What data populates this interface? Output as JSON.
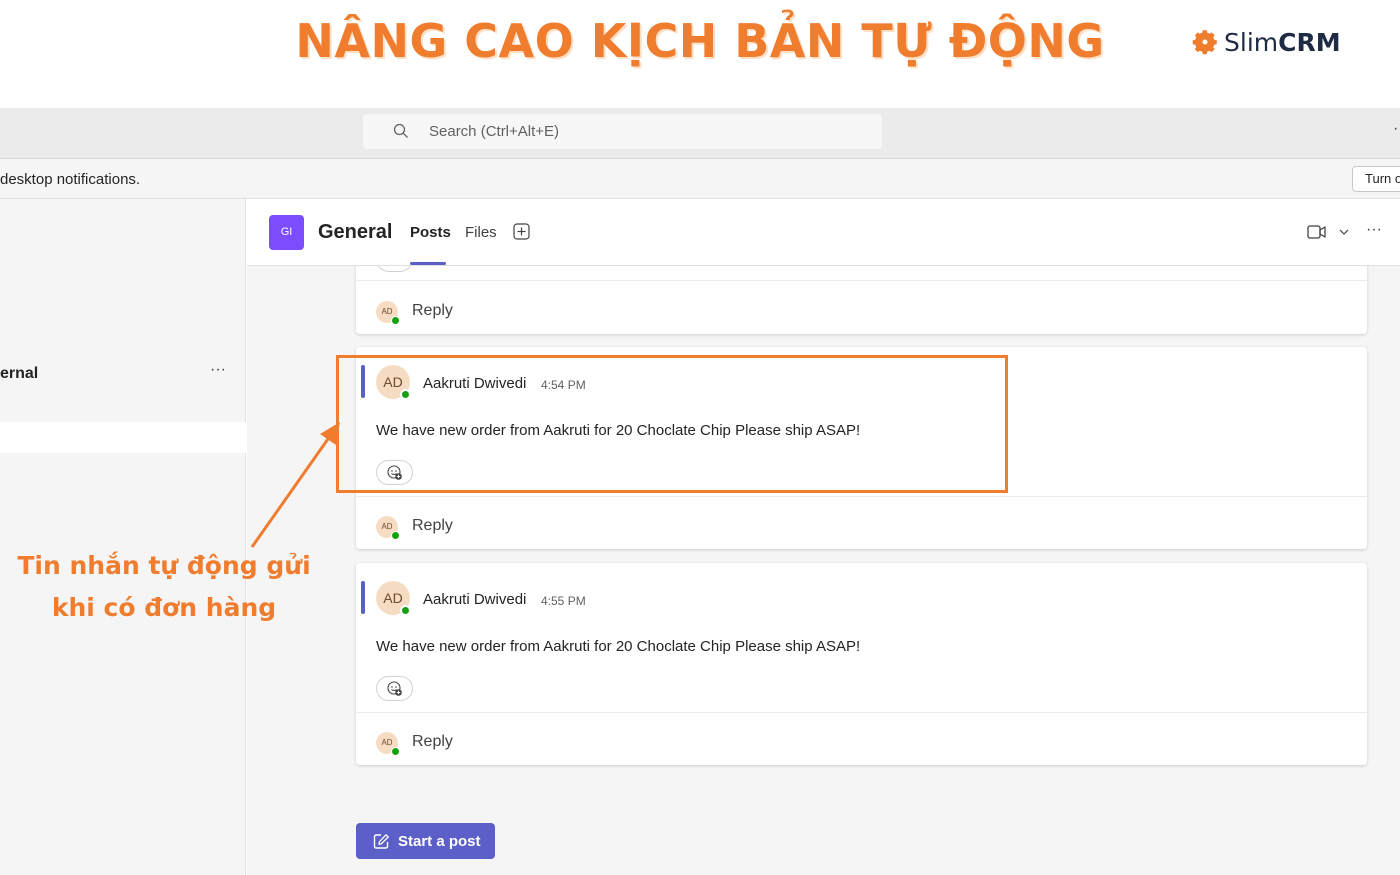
{
  "banner": {
    "title": "NÂNG CAO KỊCH BẢN TỰ ĐỘNG",
    "logo_slim": "Slim",
    "logo_crm": "CRM",
    "logo_icon": "gear-icon",
    "accent_color": "#f07c2e"
  },
  "topbar": {
    "search_placeholder": "Search (Ctrl+Alt+E)",
    "more": "···"
  },
  "notification": {
    "text": "desktop notifications.",
    "button": "Turn on"
  },
  "sidebar": {
    "team_name": "ernal",
    "more": "···"
  },
  "channel": {
    "avatar_initials": "GI",
    "title": "General",
    "tabs": [
      "Posts",
      "Files"
    ],
    "active_tab": "Posts",
    "more": "···",
    "accent_color": "#5b5fc7"
  },
  "posts": [
    {
      "initials": "AD",
      "author": "Aakruti Dwivedi",
      "time": "4:54 PM",
      "message": "We have new order from Aakruti for 20 Choclate Chip Please ship ASAP!",
      "reply_label": "Reply"
    },
    {
      "initials": "AD",
      "author": "Aakruti Dwivedi",
      "time": "4:55 PM",
      "message": "We have new order from Aakruti for 20 Choclate Chip Please ship ASAP!",
      "reply_label": "Reply"
    }
  ],
  "partial_post": {
    "initials": "AD",
    "reply_label": "Reply"
  },
  "start_post_label": "Start a post",
  "annotation": {
    "line1": "Tin nhắn tự động gửi",
    "line2": "khi có đơn hàng"
  }
}
